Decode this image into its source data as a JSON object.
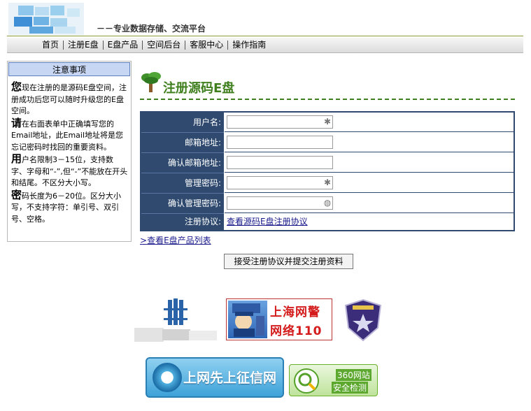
{
  "header": {
    "slogan": "－－专业数据存储、交流平台"
  },
  "nav": {
    "items": [
      {
        "label": "首页"
      },
      {
        "label": "注册E盘"
      },
      {
        "label": "E盘产品"
      },
      {
        "label": "空间后台"
      },
      {
        "label": "客服中心"
      },
      {
        "label": "操作指南"
      }
    ]
  },
  "sidebar": {
    "title": "注意事项",
    "notes": [
      {
        "big": "您",
        "text": "现在注册的是源码E盘空间，注册成功后您可以随时升级您的E盘空间。"
      },
      {
        "big": "请",
        "text": "在右面表单中正确填写您的Email地址，此Email地址将是您忘记密码时找回的重要资料。"
      },
      {
        "big": "用",
        "text": "户名限制3－15位，支持数字、字母和“-”,但“-”不能放在开头和结尾。不区分大小写。"
      },
      {
        "big": "密",
        "text": "码长度为6－20位。区分大小写，不支持字符：单引号、双引号、空格。"
      }
    ]
  },
  "main": {
    "heading": "注册源码E盘",
    "form": {
      "username_label": "用户名:",
      "email_label": "邮箱地址:",
      "email_confirm_label": "确认邮箱地址:",
      "password_label": "管理密码:",
      "password_confirm_label": "确认管理密码:",
      "agreement_label": "注册协议:",
      "agreement_link": "查看源码E盘注册协议",
      "username_value": "",
      "email_value": "",
      "email_confirm_value": "",
      "password_value": "",
      "password_confirm_value": ""
    },
    "product_list_link": "查看E盘产品列表",
    "submit_label": "接受注册协议并提交注册资料"
  },
  "badges": {
    "police_line1": "上海网警",
    "police_line2": "网络110",
    "credit": "上网先上征信网",
    "safety_line1": "360网站",
    "safety_line2": "安全检测"
  },
  "colors": {
    "nav_border": "#8a9a3a",
    "heading_green": "#3f7f1e",
    "form_navy": "#2f4a6e",
    "sidebar_title_bg": "#c7d6f3",
    "link_blue": "#1a1a8c"
  },
  "icons": {
    "tree": "tree-icon",
    "required": "asterisk-icon",
    "password_strength": "password-strength-icon"
  }
}
